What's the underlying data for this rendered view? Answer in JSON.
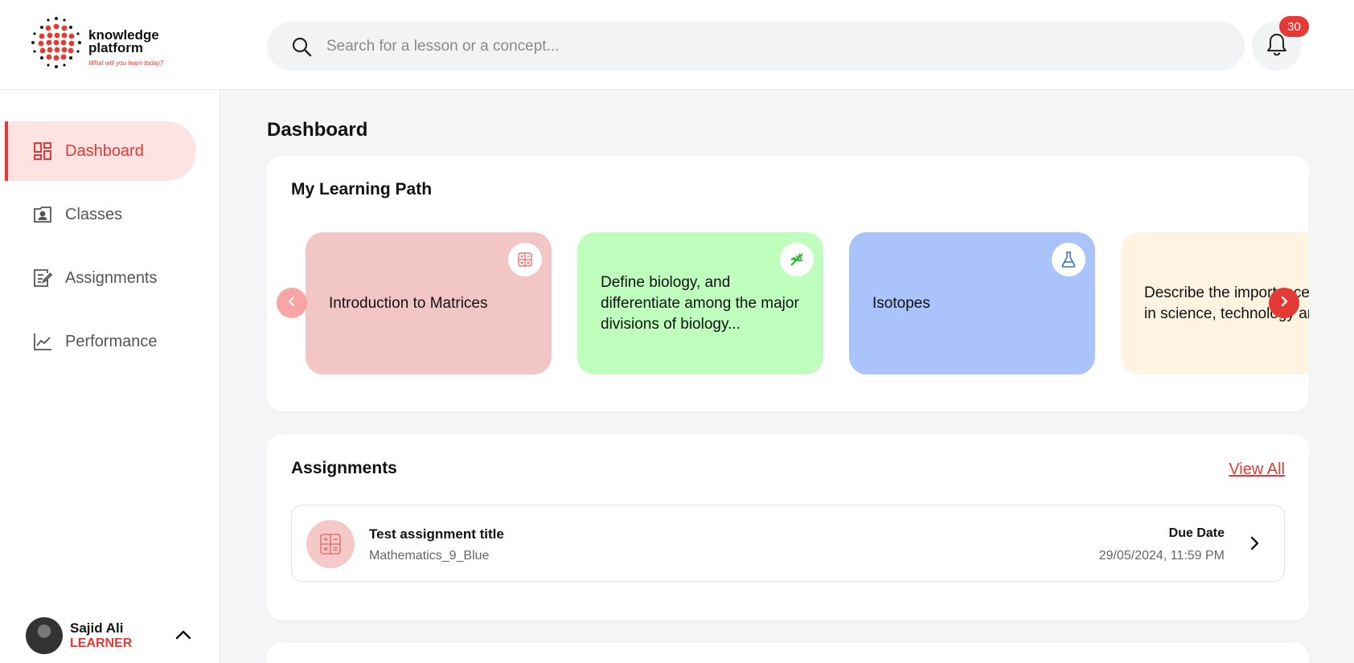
{
  "brand": {
    "name_line1": "knowledge",
    "name_line2": "platform",
    "tagline": "What will you learn today?",
    "accent_color": "#e53935"
  },
  "search": {
    "placeholder": "Search for a lesson or a concept...",
    "value": "",
    "icon": "search-icon"
  },
  "notifications": {
    "icon": "bell-icon",
    "count": "30"
  },
  "sidebar": {
    "items": [
      {
        "label": "Dashboard",
        "icon": "dashboard-icon",
        "active": true
      },
      {
        "label": "Classes",
        "icon": "classes-icon",
        "active": false
      },
      {
        "label": "Assignments",
        "icon": "assignments-icon",
        "active": false
      },
      {
        "label": "Performance",
        "icon": "performance-chart-icon",
        "active": false
      }
    ]
  },
  "user": {
    "name": "Sajid Ali",
    "role": "LEARNER"
  },
  "main": {
    "page_title": "Dashboard",
    "learning_path": {
      "title": "My Learning Path",
      "lessons": [
        {
          "title": "Introduction to Matrices",
          "color": "#f3c6c6",
          "icon": "calculator-icon",
          "icon_color": "#e57373"
        },
        {
          "title": "Define biology, and differentiate among the major divisions of biology...",
          "color": "#bfffbe",
          "icon": "dna-icon",
          "icon_color": "#2db52d"
        },
        {
          "title": "Isotopes",
          "color": "#aac3fb",
          "icon": "flask-icon",
          "icon_color": "#3b6fd8"
        },
        {
          "title": "Describe the importance of physics in science, technology and society",
          "color": "#fff4e1",
          "icon": "",
          "icon_color": ""
        }
      ]
    },
    "assignments": {
      "title": "Assignments",
      "view_all_label": "View All",
      "items": [
        {
          "title": "Test assignment title",
          "subject": "Mathematics_9_Blue",
          "due_label": "Due Date",
          "due_value": "29/05/2024, 11:59 PM",
          "icon": "calculator-icon"
        }
      ]
    }
  }
}
